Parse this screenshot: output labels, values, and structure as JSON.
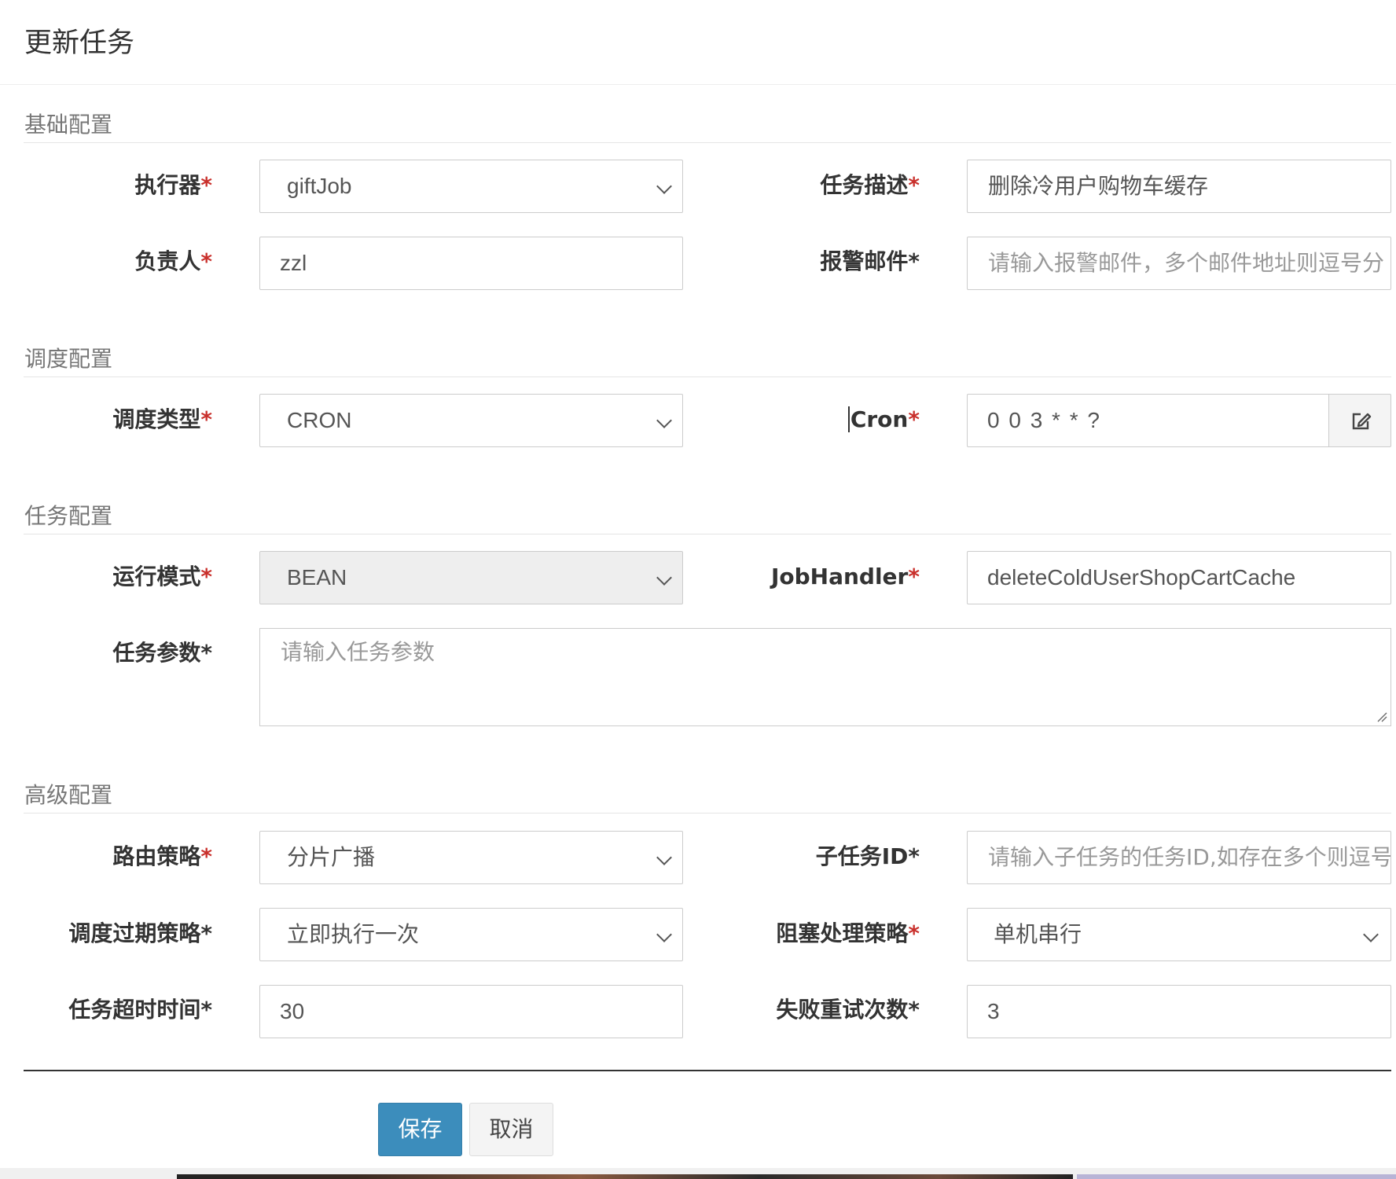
{
  "modal": {
    "title": "更新任务"
  },
  "sections": {
    "basic": "基础配置",
    "schedule": "调度配置",
    "job": "任务配置",
    "advanced": "高级配置"
  },
  "fields": {
    "executor": {
      "label": "执行器",
      "value": "giftJob"
    },
    "job_desc": {
      "label": "任务描述",
      "value": "删除冷用户购物车缓存"
    },
    "author": {
      "label": "负责人",
      "value": "zzl"
    },
    "alarm_email": {
      "label": "报警邮件*",
      "placeholder": "请输入报警邮件，多个邮件地址则逗号分"
    },
    "schedule_type": {
      "label": "调度类型",
      "value": "CRON"
    },
    "cron": {
      "label": "Cron",
      "value": "0 0 3 * * ?"
    },
    "glue_type": {
      "label": "运行模式",
      "value": "BEAN"
    },
    "job_handler": {
      "label": "JobHandler",
      "value": "deleteColdUserShopCartCache"
    },
    "job_param": {
      "label": "任务参数*",
      "placeholder": "请输入任务参数"
    },
    "route_strategy": {
      "label": "路由策略",
      "value": "分片广播"
    },
    "child_job_id": {
      "label": "子任务ID*",
      "placeholder": "请输入子任务的任务ID,如存在多个则逗号"
    },
    "misfire_strategy": {
      "label": "调度过期策略*",
      "value": "立即执行一次"
    },
    "block_strategy": {
      "label": "阻塞处理策略",
      "value": "单机串行"
    },
    "timeout": {
      "label": "任务超时时间*",
      "value": "30"
    },
    "fail_retry": {
      "label": "失败重试次数*",
      "value": "3"
    }
  },
  "required_mark": "*",
  "buttons": {
    "save": "保存",
    "cancel": "取消"
  },
  "colors": {
    "primary": "#3c8dbc",
    "required": "#c9302c",
    "section_text": "#777777"
  }
}
